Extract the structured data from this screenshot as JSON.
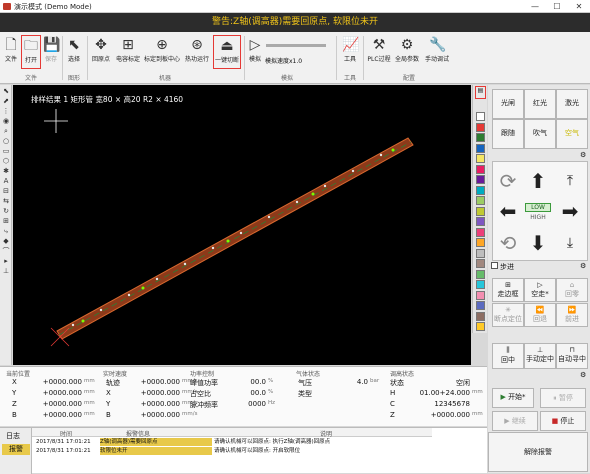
{
  "window": {
    "title": "演示模式 (Demo Mode)",
    "minimize": "—",
    "maximize": "☐",
    "close": "✕"
  },
  "warning": "警告:Z轴(调高器)需要回原点, 软限位未开",
  "ribbon": {
    "file": {
      "file_label": "文件",
      "open_label": "打开",
      "save_label": "保存",
      "group": "文件"
    },
    "figure": {
      "select_label": "选择",
      "group": "图形"
    },
    "machine": {
      "items": [
        "回原点",
        "电容标定",
        "标定到板中心",
        "热功运行",
        "一键切断"
      ],
      "group": "机器"
    },
    "simulate": {
      "label": "模拟",
      "speed": "模拟速度x1.0",
      "group": "模拟"
    },
    "tools": {
      "label": "工具",
      "group": "工具"
    },
    "config": {
      "items": [
        "PLC过程",
        "全局参数",
        "手动调试"
      ],
      "group": "配置"
    }
  },
  "canvas": {
    "label": "排样结果 1 矩形管 宽80 × 高20 R2 × 4160"
  },
  "swatch_colors": [
    "#ffffff",
    "#e53935",
    "#2e7d32",
    "#1565c0",
    "#f5e663",
    "#e91e63",
    "#6a1b9a",
    "#00acc1",
    "#9ccc65",
    "#c0ca33",
    "#7e57c2",
    "#ec407a",
    "#ffa726",
    "#bdbdbd",
    "#a1887f",
    "#66bb6a",
    "#26c6da",
    "#f48fb1",
    "#5c6bc0",
    "#8d6e63",
    "#ffca28"
  ],
  "io": {
    "buttons": [
      "光闸",
      "红光",
      "激光",
      "跟随",
      "吹气",
      "空气"
    ]
  },
  "jog": {
    "low": "LOW",
    "high": "HIGH",
    "step": "步进"
  },
  "actions": {
    "row1": [
      "走边框",
      "空走*",
      "回零"
    ],
    "row2": [
      "断点定位",
      "回退",
      "前进"
    ],
    "row3": [
      "回中",
      "手动定中",
      "自动寻中"
    ],
    "start": "开始*",
    "pause": "暂停",
    "continue": "继续",
    "stop": "停止"
  },
  "status": {
    "current_pos": {
      "title": "当前位置",
      "rows": [
        [
          "X",
          "+0000.000",
          "mm"
        ],
        [
          "Y",
          "+0000.000",
          "mm"
        ],
        [
          "Z",
          "+0000.000",
          "mm"
        ],
        [
          "B",
          "+0000.000",
          "mm"
        ]
      ]
    },
    "realtime_speed": {
      "title": "实时速度",
      "rows": [
        [
          "轨迹",
          "+0000.000",
          "mm/s"
        ],
        [
          "X",
          "+0000.000",
          "mm/s"
        ],
        [
          "Y",
          "+0000.000",
          "mm/s"
        ],
        [
          "B",
          "+0000.000",
          "mm/s"
        ]
      ]
    },
    "laser": {
      "title": "功率控制",
      "rows": [
        [
          "峰值功率",
          "00.0",
          "%"
        ],
        [
          "占空比",
          "00.0",
          "%"
        ],
        [
          "脉冲频率",
          "0000",
          "Hz"
        ]
      ]
    },
    "gas": {
      "title": "气体状态",
      "rows": [
        [
          "气压",
          "4.0",
          "bar"
        ],
        [
          "类型",
          ""
        ]
      ]
    },
    "height": {
      "title": "调高状态",
      "rows": [
        [
          "状态",
          "空闲"
        ],
        [
          "H",
          "01.00+24.000",
          "mm"
        ],
        [
          "C",
          "12345678"
        ],
        [
          "Z",
          "+0000.000",
          "mm"
        ]
      ]
    }
  },
  "log": {
    "tabs": [
      "日志",
      "报警"
    ],
    "headers": [
      "时间",
      "报警信息",
      "说明"
    ],
    "rows": [
      [
        "2017/8/31 17:01:21",
        "Z轴(调高器)需要回原点",
        "请确认机械可以回原点: 执行Z轴(调高器)回原点"
      ],
      [
        "2017/8/31 17:01:21",
        "软限位未开",
        "请确认机械可以回原点: 开启软限位"
      ]
    ],
    "clear": "解除报警"
  }
}
